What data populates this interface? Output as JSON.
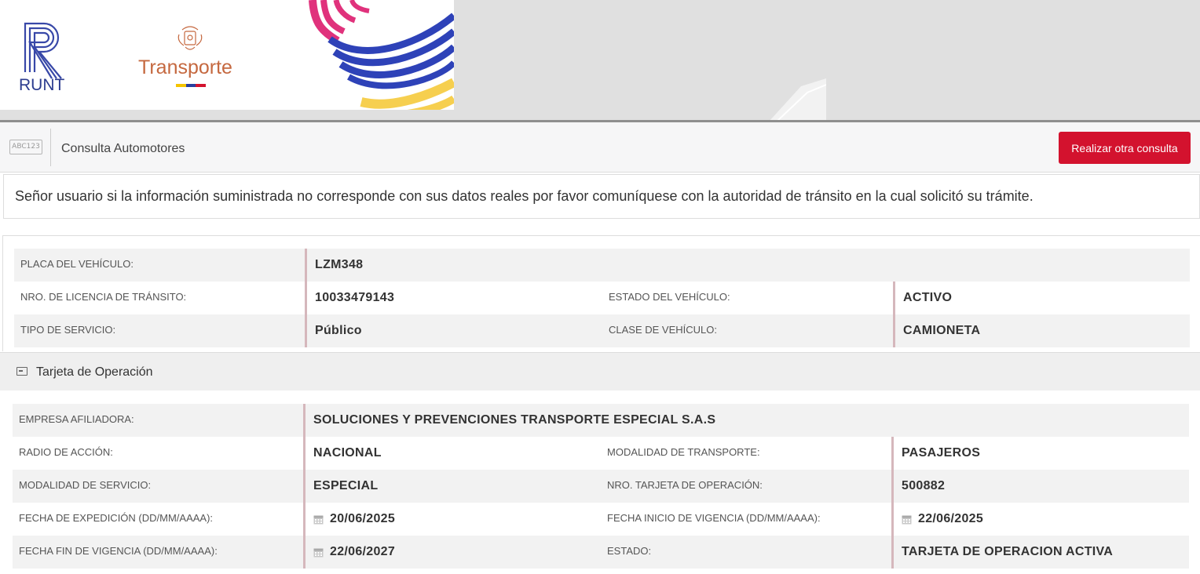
{
  "header": {
    "runt_label": "RUNT",
    "transporte_label": "Transporte",
    "colors": {
      "runt_blue": "#2c3c8f",
      "transporte_orange": "#c5683f",
      "accent_red": "#d3122e"
    }
  },
  "querybar": {
    "icon": "abc123-plate-icon",
    "icon_text": "ABC123",
    "title": "Consulta Automotores",
    "button_label": "Realizar otra consulta"
  },
  "notice": {
    "text": "Señor usuario si la información suministrada no corresponde con sus datos reales por favor comuníquese con la autoridad de tránsito en la cual solicitó su trámite."
  },
  "vehicle": {
    "placa_label": "PLACA DEL VEHÍCULO:",
    "placa_value": "LZM348",
    "licencia_label": "NRO. DE LICENCIA DE TRÁNSITO:",
    "licencia_value": "10033479143",
    "estado_label": "ESTADO DEL VEHÍCULO:",
    "estado_value": "ACTIVO",
    "servicio_label": "TIPO DE SERVICIO:",
    "servicio_value": "Público",
    "clase_label": "CLASE DE VEHÍCULO:",
    "clase_value": "CAMIONETA"
  },
  "tarjeta": {
    "section_title": "Tarjeta de Operación",
    "section_icon": "card-icon",
    "empresa_label": "EMPRESA AFILIADORA:",
    "empresa_value": "SOLUCIONES Y PREVENCIONES TRANSPORTE ESPECIAL S.A.S",
    "radio_label": "RADIO DE ACCIÓN:",
    "radio_value": "NACIONAL",
    "modalidad_transporte_label": "MODALIDAD DE TRANSPORTE:",
    "modalidad_transporte_value": "PASAJEROS",
    "modalidad_servicio_label": "MODALIDAD DE SERVICIO:",
    "modalidad_servicio_value": "ESPECIAL",
    "nro_tarjeta_label": "NRO. TARJETA DE OPERACIÓN:",
    "nro_tarjeta_value": "500882",
    "expedicion_label": "FECHA DE EXPEDICIÓN (DD/MM/AAAA):",
    "expedicion_value": "20/06/2025",
    "inicio_label": "FECHA INICIO DE VIGENCIA (DD/MM/AAAA):",
    "inicio_value": "22/06/2025",
    "fin_label": "FECHA FIN DE VIGENCIA (DD/MM/AAAA):",
    "fin_value": "22/06/2027",
    "estado_label": "ESTADO:",
    "estado_value": "TARJETA DE OPERACION ACTIVA"
  }
}
